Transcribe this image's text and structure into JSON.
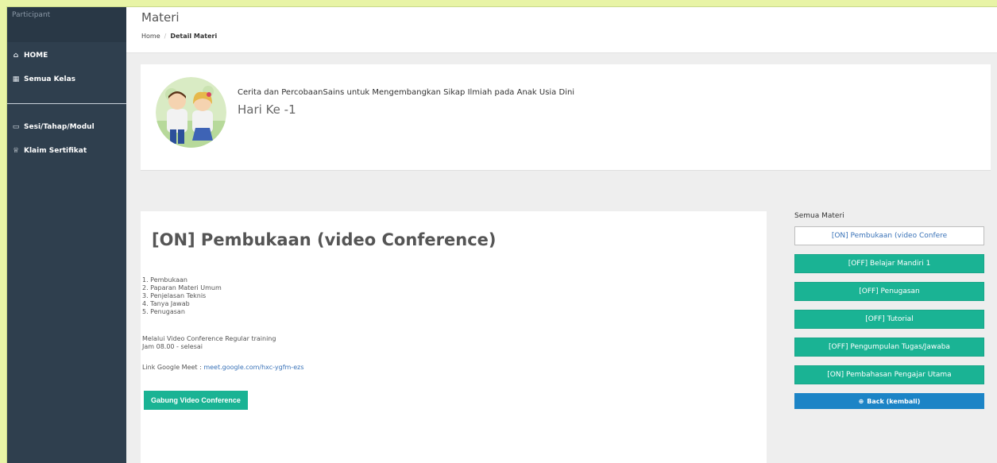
{
  "sidebar": {
    "role": "Participant",
    "items": [
      {
        "label": "HOME",
        "icon": "home-icon",
        "glyph": "⌂"
      },
      {
        "label": "Semua Kelas",
        "icon": "calendar-icon",
        "glyph": "▦"
      },
      {
        "label": "Sesi/Tahap/Modul",
        "icon": "folder-icon",
        "glyph": "▭"
      },
      {
        "label": "Klaim Sertifikat",
        "icon": "trophy-icon",
        "glyph": "♕"
      }
    ]
  },
  "header": {
    "title": "Materi",
    "breadcrumb": {
      "home": "Home",
      "separator": "/",
      "current": "Detail Materi"
    }
  },
  "hero": {
    "course_title": "Cerita dan PercobaanSains untuk Mengembangkan Sikap Ilmiah pada Anak Usia Dini",
    "day": "Hari Ke -1"
  },
  "content": {
    "title": "[ON] Pembukaan (video Conference)",
    "agenda": [
      "1. Pembukaan",
      "2. Paparan Materi Umum",
      "3. Penjelasan Teknis",
      "4. Tanya Jawab",
      "5. Penugasan"
    ],
    "note_line1": "Melalui Video Conference Regular training",
    "note_line2": "Jam 08.00 - selesai",
    "link_label": "Link  Google Meet : ",
    "link_url": "meet.google.com/hxc-ygfm-ezs",
    "join_button": "Gabung Video Conference"
  },
  "materials": {
    "heading": "Semua Materi",
    "items": [
      {
        "label": "[ON] Pembukaan (video Confere",
        "style": "outline"
      },
      {
        "label": "[OFF] Belajar Mandiri 1",
        "style": "green"
      },
      {
        "label": "[OFF] Penugasan",
        "style": "green"
      },
      {
        "label": "[OFF] Tutorial",
        "style": "green"
      },
      {
        "label": "[OFF] Pengumpulan Tugas/Jawaba",
        "style": "green"
      },
      {
        "label": "[ON] Pembahasan Pengajar Utama",
        "style": "green"
      }
    ],
    "back_button": "Back (kembali)"
  },
  "colors": {
    "sidebar": "#2f3f4e",
    "accent_green": "#1ab394",
    "accent_blue": "#1c84c6",
    "page_bg": "#e8f4a6"
  }
}
